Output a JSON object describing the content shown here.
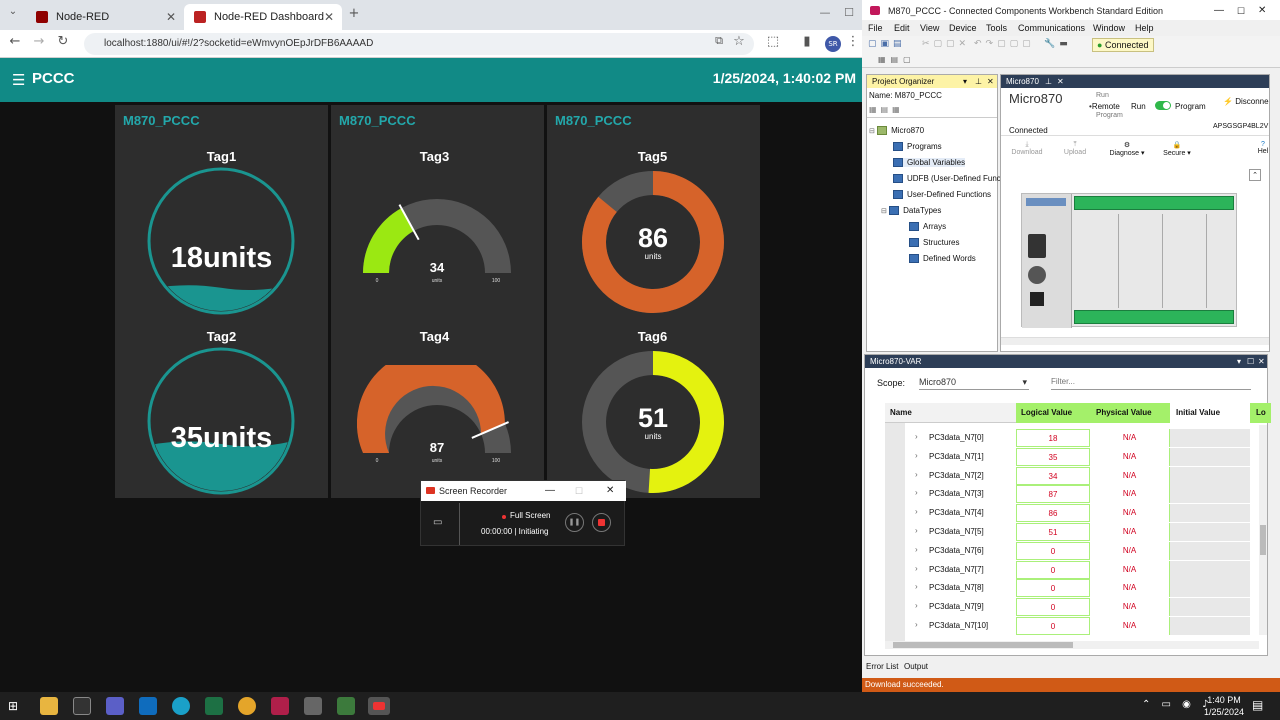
{
  "browser": {
    "tabs": [
      {
        "label": "Node-RED",
        "active": false
      },
      {
        "label": "Node-RED Dashboard",
        "active": true
      }
    ],
    "url": "localhost:1880/ui/#!/2?socketid=eWmvynOEpJrDFB6AAAAD",
    "profile_initials": "SR"
  },
  "dashboard": {
    "title": "PCCC",
    "datetime": "1/25/2024, 1:40:02 PM",
    "groups": [
      {
        "title": "M870_PCCC"
      },
      {
        "title": "M870_PCCC"
      },
      {
        "title": "M870_PCCC"
      }
    ],
    "widgets": {
      "tag1": {
        "label": "Tag1",
        "value": 18,
        "text": "18units",
        "level": 0.18
      },
      "tag2": {
        "label": "Tag2",
        "value": 35,
        "text": "35units",
        "level": 0.35
      },
      "tag3": {
        "label": "Tag3",
        "value": 34,
        "display": "34",
        "units": "units",
        "min": "0",
        "max": "100",
        "color": "#9be812"
      },
      "tag4": {
        "label": "Tag4",
        "value": 87,
        "display": "87",
        "units": "units",
        "min": "0",
        "max": "100",
        "color": "#d6632a"
      },
      "tag5": {
        "label": "Tag5",
        "value": 86,
        "display": "86",
        "units": "units",
        "color": "#d6632a"
      },
      "tag6": {
        "label": "Tag6",
        "value": 51,
        "display": "51",
        "units": "units",
        "color": "#e4f20f"
      }
    },
    "colors": {
      "header": "#118a86",
      "accent": "#23a8ab",
      "tank_fill": "#1a9590"
    }
  },
  "recorder": {
    "title": "Screen Recorder",
    "mode": "Full Screen",
    "time": "00:00:00",
    "status": "Initiating"
  },
  "ccw": {
    "title": "M870_PCCC - Connected Components Workbench Standard Edition",
    "menu": [
      "File",
      "Edit",
      "View",
      "Device",
      "Tools",
      "Communications",
      "Window",
      "Help"
    ],
    "connection": "Connected",
    "project_organizer": {
      "title": "Project Organizer",
      "name_label": "Name:",
      "name_value": "M870_PCCC",
      "tree": [
        "Micro870",
        "Programs",
        "Global Variables",
        "UDFB (User-Defined Func",
        "User-Defined Functions",
        "DataTypes",
        "Arrays",
        "Structures",
        "Defined Words"
      ]
    },
    "device": {
      "tab": "Micro870",
      "name": "Micro870",
      "status": "Connected",
      "run": "Run",
      "remote": "Remote",
      "run_mode": "Run",
      "program_mode": "Program",
      "program_sub": "Program",
      "disconnect": "Disconne",
      "catalog": "APSGSGP4BL2V",
      "actions": [
        "Download",
        "Upload",
        "Diagnose",
        "Secure",
        "Hel"
      ]
    },
    "variables": {
      "title": "Micro870-VAR",
      "scope_label": "Scope:",
      "scope_value": "Micro870",
      "filter_placeholder": "Filter...",
      "columns": [
        "Name",
        "Logical Value",
        "Physical Value",
        "Initial Value",
        "Lo"
      ],
      "rows": [
        {
          "name": "PC3data_N7[0]",
          "logical": "18",
          "physical": "N/A"
        },
        {
          "name": "PC3data_N7[1]",
          "logical": "35",
          "physical": "N/A"
        },
        {
          "name": "PC3data_N7[2]",
          "logical": "34",
          "physical": "N/A"
        },
        {
          "name": "PC3data_N7[3]",
          "logical": "87",
          "physical": "N/A"
        },
        {
          "name": "PC3data_N7[4]",
          "logical": "86",
          "physical": "N/A"
        },
        {
          "name": "PC3data_N7[5]",
          "logical": "51",
          "physical": "N/A"
        },
        {
          "name": "PC3data_N7[6]",
          "logical": "0",
          "physical": "N/A"
        },
        {
          "name": "PC3data_N7[7]",
          "logical": "0",
          "physical": "N/A"
        },
        {
          "name": "PC3data_N7[8]",
          "logical": "0",
          "physical": "N/A"
        },
        {
          "name": "PC3data_N7[9]",
          "logical": "0",
          "physical": "N/A"
        },
        {
          "name": "PC3data_N7[10]",
          "logical": "0",
          "physical": "N/A"
        }
      ]
    },
    "bottom_tabs": [
      "Error List",
      "Output"
    ],
    "status": "Download succeeded."
  },
  "taskbar": {
    "time": "1:40 PM",
    "date": "1/25/2024"
  }
}
